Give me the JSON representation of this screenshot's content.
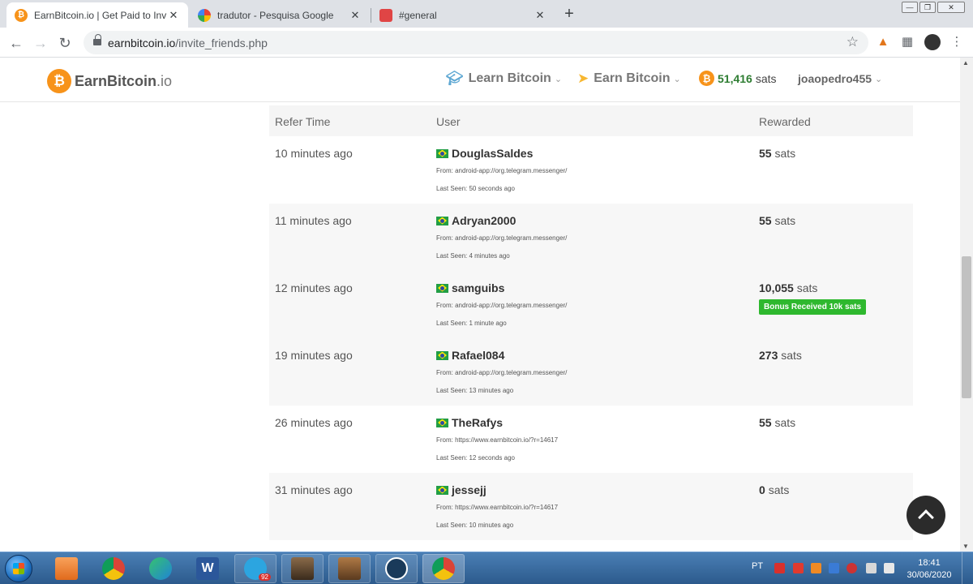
{
  "browser": {
    "tabs": [
      {
        "title": "EarnBitcoin.io | Get Paid to Invite",
        "favicon": "bitcoin-icon",
        "active": true
      },
      {
        "title": "tradutor - Pesquisa Google",
        "favicon": "google-icon",
        "active": false
      },
      {
        "title": "#general",
        "favicon": "chat-app-icon",
        "active": false
      }
    ],
    "tab_close": "✕",
    "new_tab": "+",
    "url_host": "earnbitcoin.io",
    "url_path": "/invite_friends.php"
  },
  "header": {
    "logo_main": "EarnBitcoin",
    "logo_suffix": ".io",
    "nav": [
      {
        "label": "Learn Bitcoin",
        "icon": "graduation-cap-icon"
      },
      {
        "label": "Earn Bitcoin",
        "icon": "rocket-icon"
      }
    ],
    "balance_amount": "51,416",
    "balance_unit": "sats",
    "username": "joaopedro455"
  },
  "table": {
    "headers": {
      "time": "Refer Time",
      "user": "User",
      "reward": "Rewarded"
    },
    "rows": [
      {
        "time": "10 minutes ago",
        "user": "DouglasSaldes",
        "from": "From: android-app://org.telegram.messenger/",
        "seen": "Last Seen: 50 seconds ago",
        "amount": "55",
        "unit": "sats",
        "badge": ""
      },
      {
        "time": "11 minutes ago",
        "user": "Adryan2000",
        "from": "From: android-app://org.telegram.messenger/",
        "seen": "Last Seen: 4 minutes ago",
        "amount": "55",
        "unit": "sats",
        "badge": ""
      },
      {
        "time": "12 minutes ago",
        "user": "samguibs",
        "from": "From: android-app://org.telegram.messenger/",
        "seen": "Last Seen: 1 minute ago",
        "amount": "10,055",
        "unit": "sats",
        "badge": "Bonus Received 10k sats"
      },
      {
        "time": "19 minutes ago",
        "user": "Rafael084",
        "from": "From: android-app://org.telegram.messenger/",
        "seen": "Last Seen: 13 minutes ago",
        "amount": "273",
        "unit": "sats",
        "badge": ""
      },
      {
        "time": "26 minutes ago",
        "user": "TheRafys",
        "from": "From: https://www.earnbitcoin.io/?r=14617",
        "seen": "Last Seen: 12 seconds ago",
        "amount": "55",
        "unit": "sats",
        "badge": ""
      },
      {
        "time": "31 minutes ago",
        "user": "jessejj",
        "from": "From: https://www.earnbitcoin.io/?r=14617",
        "seen": "Last Seen: 10 minutes ago",
        "amount": "0",
        "unit": "sats",
        "badge": ""
      }
    ]
  },
  "taskbar": {
    "telegram_badge": "92",
    "language": "PT",
    "time": "18:41",
    "date": "30/06/2020"
  },
  "colors": {
    "brand": "#f7931a",
    "balance_green": "#2e7d32",
    "bonus_badge": "#2eb82e"
  }
}
